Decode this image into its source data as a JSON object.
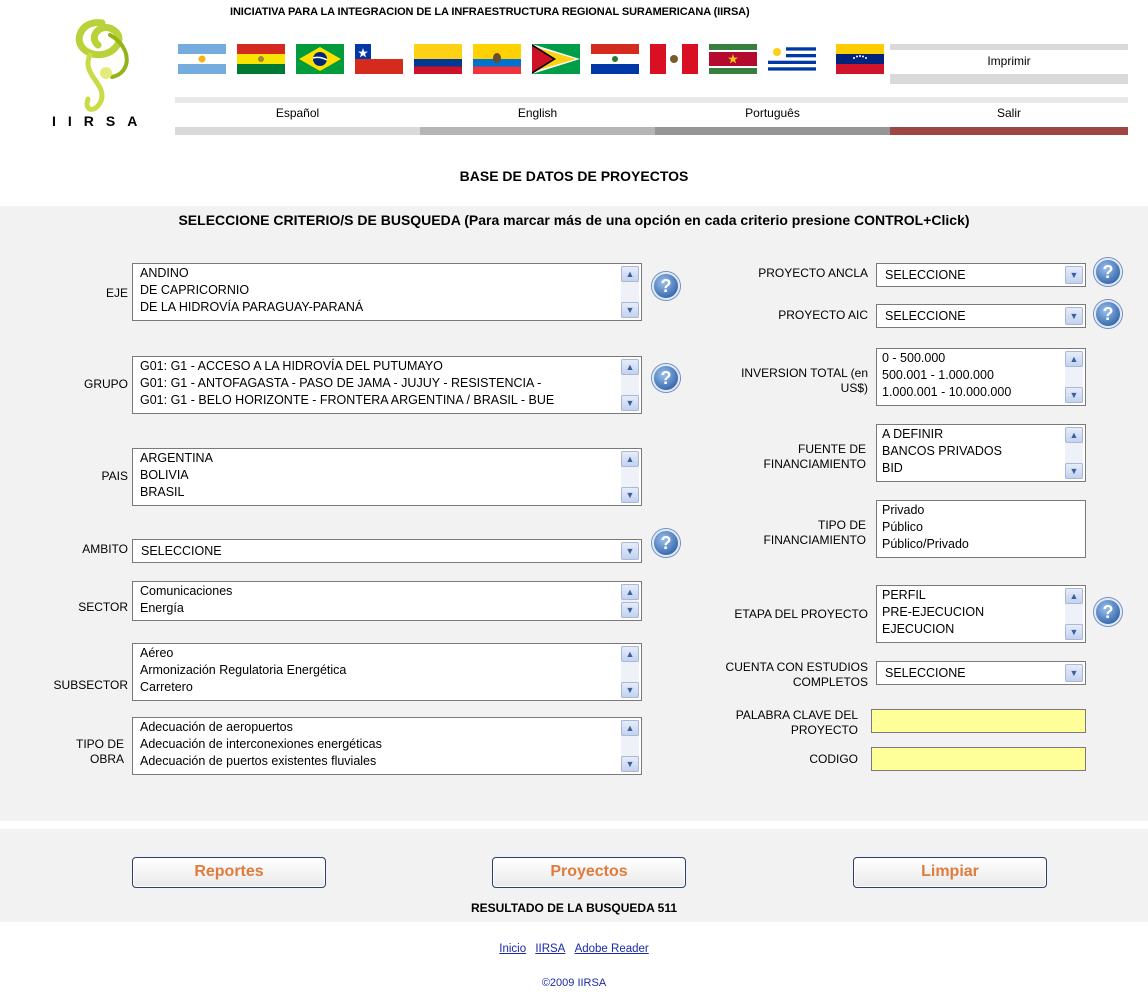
{
  "header": {
    "initiative": "INICIATIVA PARA LA INTEGRACION DE LA INFRAESTRUCTURA REGIONAL SURAMERICANA (IIRSA)",
    "logo_text": "IIRSA",
    "print_label": "Imprimir",
    "flags": [
      "argentina-flag",
      "bolivia-flag",
      "brazil-flag",
      "chile-flag",
      "colombia-flag",
      "ecuador-flag",
      "guyana-flag",
      "paraguay-flag",
      "peru-flag",
      "suriname-flag",
      "uruguay-flag",
      "venezuela-flag"
    ],
    "languages": [
      {
        "label": "Español",
        "color": "#d9d9d9"
      },
      {
        "label": "English",
        "color": "#b5b5b5"
      },
      {
        "label": "Português",
        "color": "#969696"
      },
      {
        "label": "Salir",
        "color": "#9e4642"
      }
    ]
  },
  "page_title": "BASE DE DATOS DE PROYECTOS",
  "criteria_title": "SELECCIONE CRITERIO/S DE BUSQUEDA (Para marcar más de una opción en cada criterio presione CONTROL+Click)",
  "left": {
    "eje": {
      "label": "EJE",
      "options": [
        "ANDINO",
        "DE CAPRICORNIO",
        "DE LA HIDROVÍA PARAGUAY-PARANÁ"
      ]
    },
    "grupo": {
      "label": "GRUPO",
      "options": [
        "G01: G1 - ACCESO A LA HIDROVÍA DEL PUTUMAYO",
        "G01: G1 - ANTOFAGASTA - PASO DE JAMA - JUJUY - RESISTENCIA -",
        "G01: G1 - BELO HORIZONTE - FRONTERA ARGENTINA / BRASIL - BUE"
      ]
    },
    "pais": {
      "label": "PAIS",
      "options": [
        "ARGENTINA",
        "BOLIVIA",
        "BRASIL"
      ]
    },
    "ambito": {
      "label": "AMBITO",
      "value": "SELECCIONE"
    },
    "sector": {
      "label": "SECTOR",
      "options": [
        "Comunicaciones",
        "Energía"
      ]
    },
    "subsector": {
      "label": "SUBSECTOR",
      "options": [
        "Aéreo",
        "Armonización Regulatoria Energética",
        "Carretero"
      ]
    },
    "tipo_obra": {
      "label_1": "TIPO DE",
      "label_2": "OBRA",
      "options": [
        "Adecuación de aeropuertos",
        "Adecuación de interconexiones energéticas",
        "Adecuación de puertos existentes fluviales"
      ]
    }
  },
  "right": {
    "proyecto_ancla": {
      "label": "PROYECTO ANCLA",
      "value": "SELECCIONE"
    },
    "proyecto_aic": {
      "label": "PROYECTO AIC",
      "value": "SELECCIONE"
    },
    "inversion": {
      "label_1": "INVERSION TOTAL (en",
      "label_2": "US$)",
      "options": [
        "0 - 500.000",
        "500.001 - 1.000.000",
        "1.000.001 - 10.000.000"
      ]
    },
    "fuente": {
      "label_1": "FUENTE DE",
      "label_2": "FINANCIAMIENTO",
      "options": [
        "A DEFINIR",
        "BANCOS PRIVADOS",
        "BID"
      ]
    },
    "tipo_financiamiento": {
      "label_1": "TIPO DE",
      "label_2": "FINANCIAMIENTO",
      "options": [
        "Privado",
        "Público",
        "Público/Privado"
      ]
    },
    "etapa": {
      "label": "ETAPA DEL PROYECTO",
      "options": [
        "PERFIL",
        "PRE-EJECUCION",
        "EJECUCION"
      ]
    },
    "estudios": {
      "label_1": "CUENTA CON ESTUDIOS",
      "label_2": "COMPLETOS",
      "value": "SELECCIONE"
    },
    "palabra": {
      "label_1": "PALABRA CLAVE DEL",
      "label_2": "PROYECTO",
      "value": ""
    },
    "codigo": {
      "label": "CODIGO",
      "value": ""
    }
  },
  "buttons": {
    "reportes": "Reportes",
    "proyectos": "Proyectos",
    "limpiar": "Limpiar"
  },
  "result": {
    "label": "RESULTADO DE LA BUSQUEDA",
    "count": "511"
  },
  "footer": {
    "links": [
      "Inicio",
      "IIRSA",
      "Adobe Reader"
    ],
    "copyright": "©2009 IIRSA"
  },
  "help_glyph": "?",
  "arrows": {
    "up": "▲",
    "down": "▼"
  }
}
